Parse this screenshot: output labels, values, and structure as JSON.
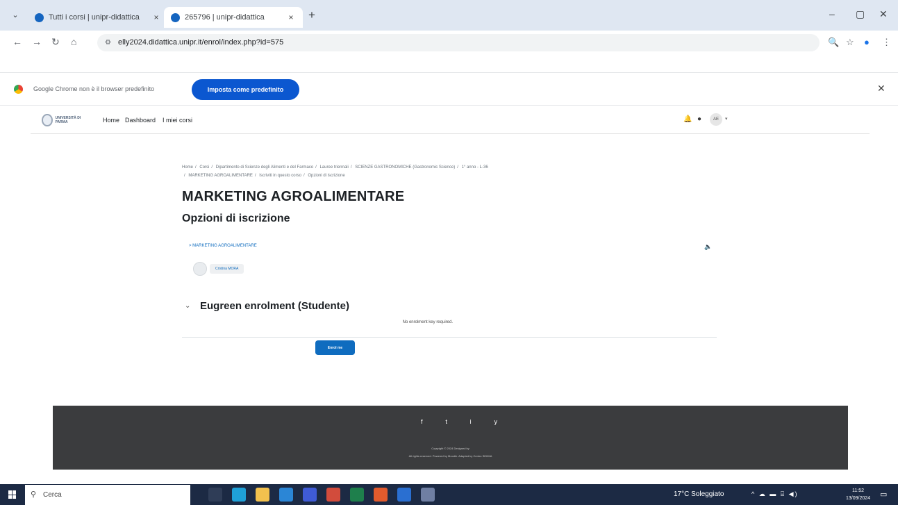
{
  "browser": {
    "tabs": [
      {
        "title": "Tutti i corsi | unipr-didattica"
      },
      {
        "title": "265796 | unipr-didattica"
      }
    ],
    "new_tab": "+",
    "url": "elly2024.didattica.unipr.it/enrol/index.php?id=575",
    "infobar": {
      "message": "Google Chrome non è il browser predefinito",
      "button": "Imposta come predefinito"
    }
  },
  "moodle_nav": {
    "logo_text": "UNIVERSITÀ DI PARMA",
    "links": [
      "Home",
      "Dashboard",
      "I miei corsi"
    ],
    "avatar_initials": "AE"
  },
  "breadcrumb": {
    "line1": [
      "Home",
      "Corsi",
      "Dipartimento di Scienze degli Alimenti e del Farmaco",
      "Lauree triennali",
      "SCIENZE GASTRONOMICHE (Gastronomic Science)",
      "1° anno - L-36"
    ],
    "line2": [
      "MARKETING AGROALIMENTARE",
      "Iscriviti in questo corso",
      "Opzioni di iscrizione"
    ]
  },
  "course": {
    "title": "MARKETING AGROALIMENTARE",
    "subtitle": "Opzioni di iscrizione",
    "link_name": "MARKETING AGROALIMENTARE",
    "teacher": "Cristina MORA"
  },
  "enrolment": {
    "heading": "Eugreen enrolment (Studente)",
    "no_key": "No enrolment key required.",
    "button": "Enrol me"
  },
  "footer": {
    "social": [
      "f",
      "t",
      "i",
      "y"
    ],
    "copyright": "Copyright © 2024 Designed by",
    "rights": "All rights reserved. Powered by Moodle. Adapted by Centro SIDIMA"
  },
  "taskbar": {
    "search_placeholder": "Cerca",
    "weather": "17°C Soleggiato",
    "time": "11:52",
    "date": "13/09/2024"
  }
}
